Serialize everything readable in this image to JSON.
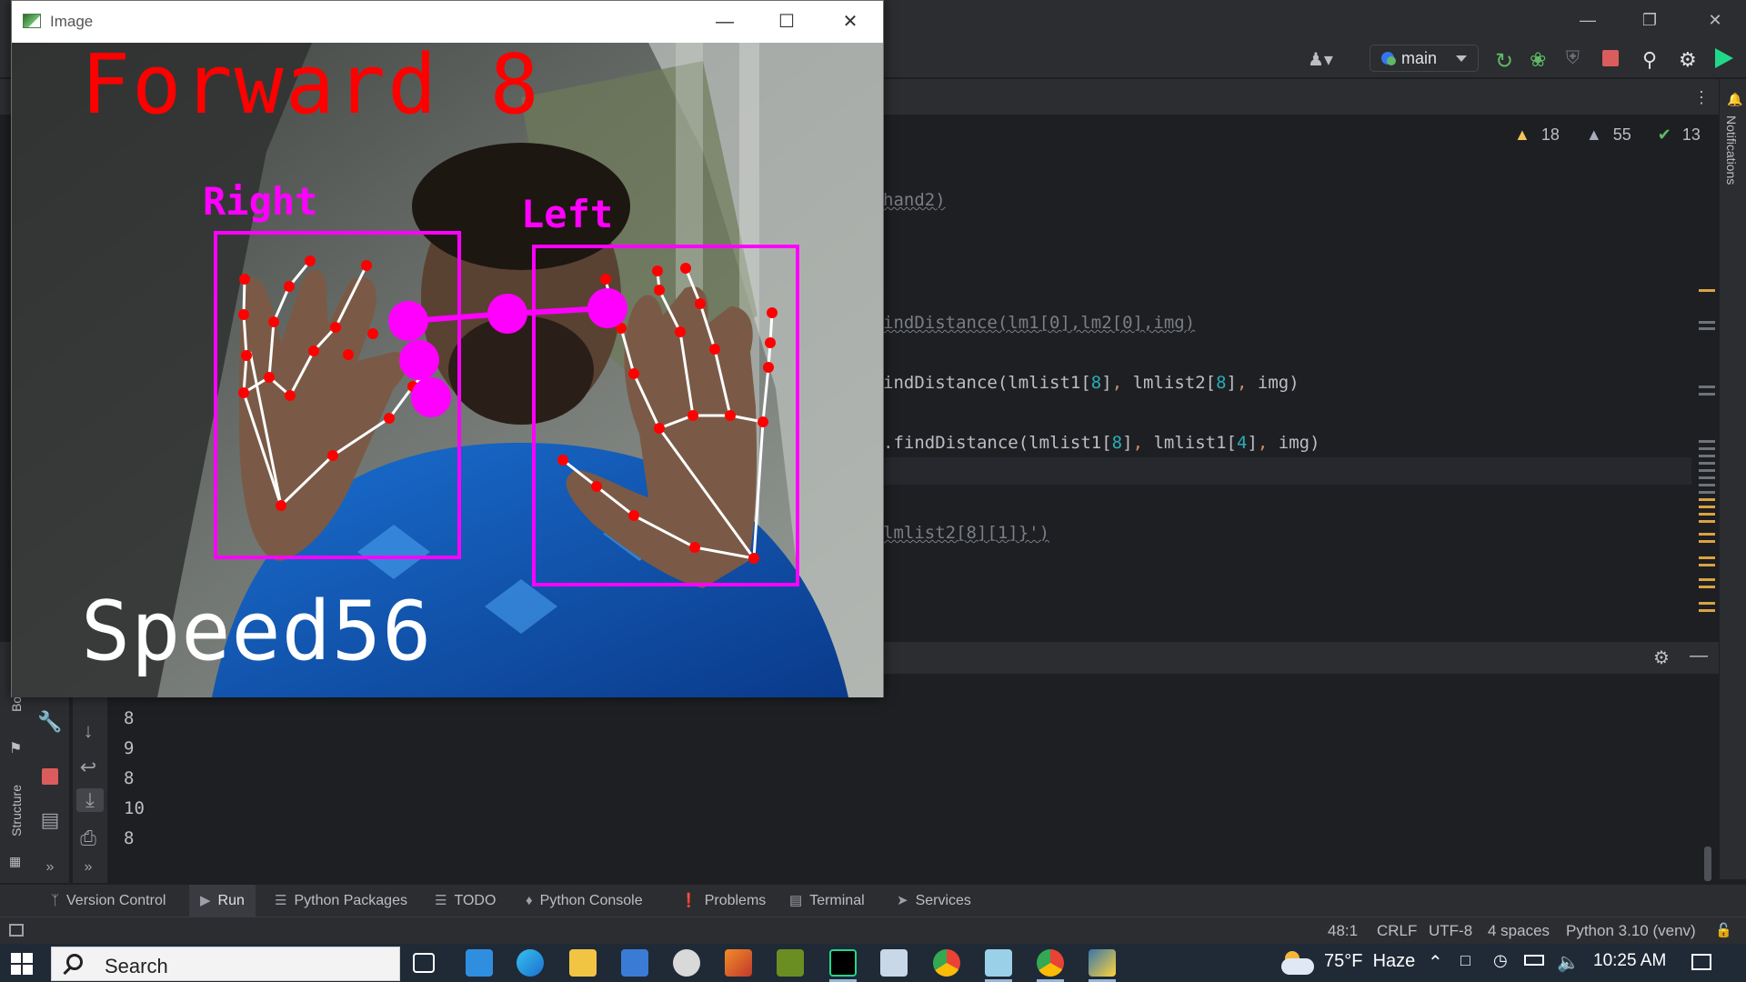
{
  "ide": {
    "branch": "main",
    "inspections": {
      "warnings": "18",
      "weak_warnings": "55",
      "ok": "13"
    },
    "code_lines": [
      {
        "text": "hand2)",
        "muted": true
      },
      {
        "text": "indDistance(lm1[0],lm2[0],img)",
        "muted": true
      },
      {
        "parts": [
          "indDistance(lmlist1[",
          "8",
          "]",
          ",",
          " lmlist2[",
          "8",
          "]",
          ",",
          " img)"
        ]
      },
      {
        "parts": [
          ".findDistance(lmlist1[",
          "8",
          "]",
          ",",
          " lmlist1[",
          "4",
          "]",
          ",",
          " img)"
        ]
      },
      {
        "text": "lmlist2[8][1]}')",
        "muted": true
      }
    ],
    "notifications_label": "Notifications",
    "side_labels": {
      "bookmarks": "Book",
      "structure": "Structure"
    },
    "run_output": [
      "8",
      "9",
      "8",
      "10",
      "8"
    ]
  },
  "tool_tabs": [
    {
      "label": "Version Control",
      "icon": "version-control-icon",
      "active": false
    },
    {
      "label": "Run",
      "icon": "run-icon",
      "active": true
    },
    {
      "label": "Python Packages",
      "icon": "python-packages-icon",
      "active": false
    },
    {
      "label": "TODO",
      "icon": "todo-icon",
      "active": false
    },
    {
      "label": "Python Console",
      "icon": "python-console-icon",
      "active": false
    },
    {
      "label": "Problems",
      "icon": "problems-icon",
      "active": false
    },
    {
      "label": "Terminal",
      "icon": "terminal-icon",
      "active": false
    },
    {
      "label": "Services",
      "icon": "services-icon",
      "active": false
    }
  ],
  "status_bar": {
    "position": "48:1",
    "line_ending": "CRLF",
    "encoding": "UTF-8",
    "indent": "4 spaces",
    "interpreter": "Python 3.10 (venv)"
  },
  "image_window": {
    "title": "Image",
    "forward_text": "Forward 8",
    "right_label": "Right",
    "left_label": "Left",
    "speed_text": "Speed56",
    "overlay_colors": {
      "landmark": "#ff0000",
      "box": "#ff00ff",
      "connector": "#ffffff"
    }
  },
  "taskbar": {
    "search_placeholder": "Search",
    "weather": "75°F  Haze",
    "time": "10:25 AM",
    "apps": [
      "task-view",
      "mail",
      "edge",
      "file-explorer",
      "store",
      "paint",
      "matlab",
      "app-bird",
      "pycharm",
      "notepad-paint",
      "chrome",
      "app-sheet",
      "chrome-2",
      "python-app"
    ]
  },
  "colors": {
    "ide_bg": "#1e1f22",
    "panel_bg": "#2b2d30",
    "accent": "#3574f0",
    "warning": "#f2c55c"
  }
}
